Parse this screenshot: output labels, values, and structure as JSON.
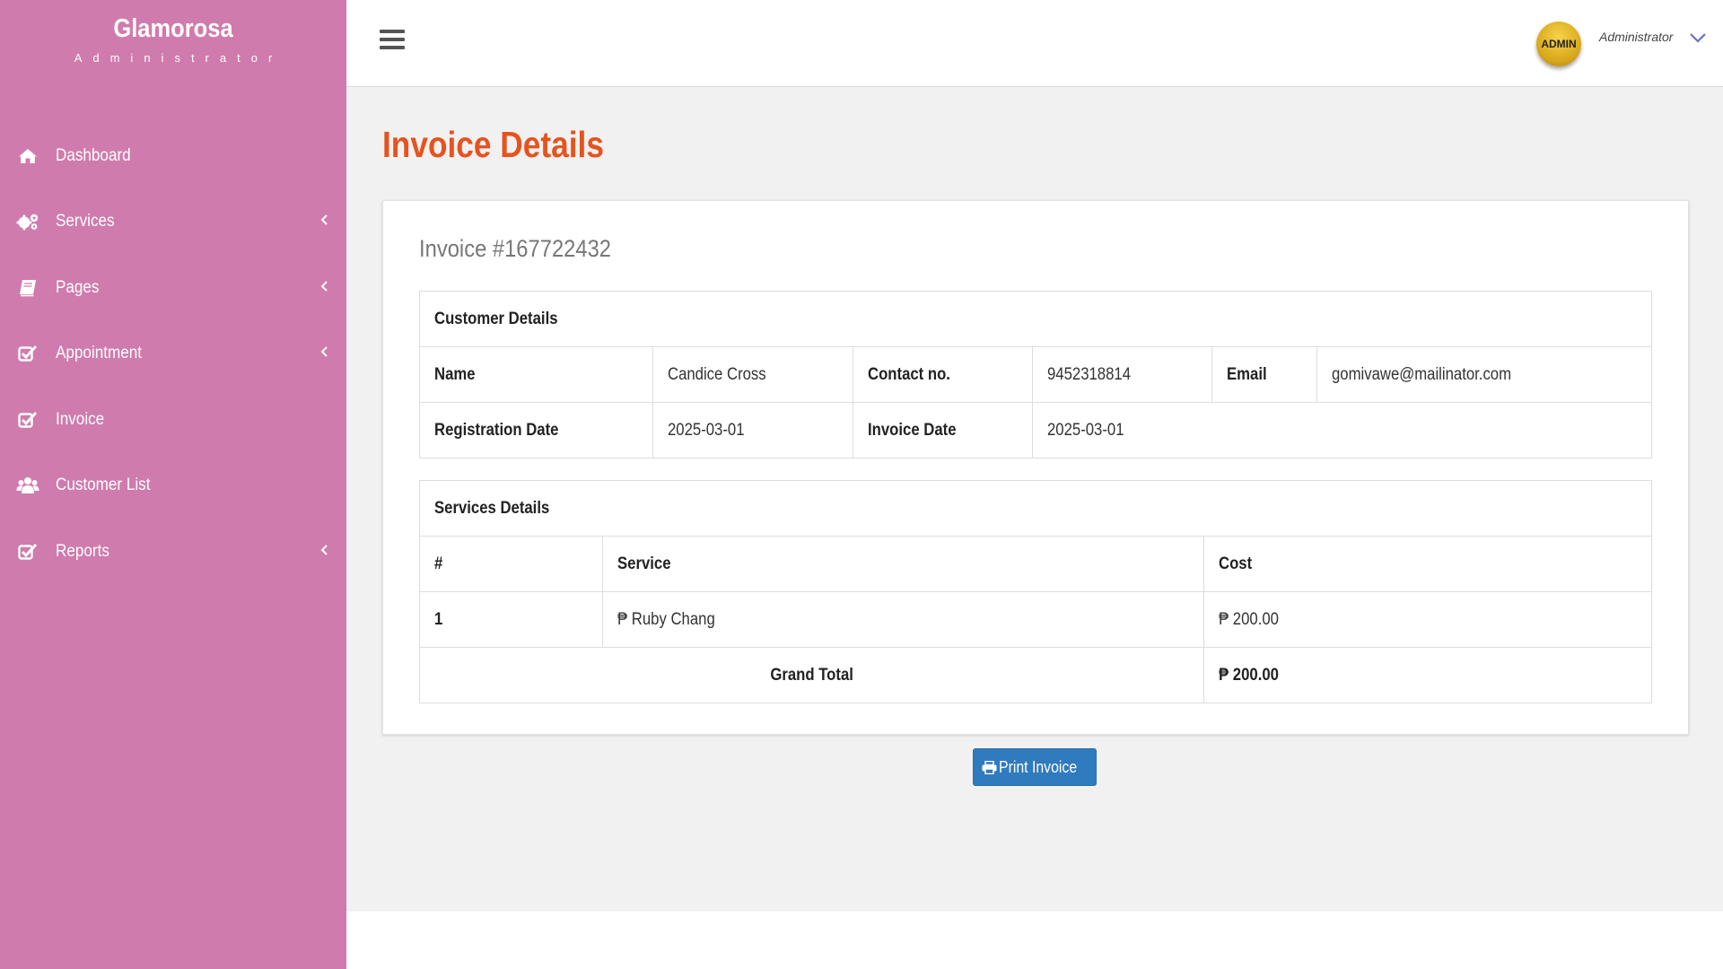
{
  "brand": {
    "title": "Glamorosa",
    "subtitle": "Administrator"
  },
  "sidebar": {
    "items": [
      {
        "label": "Dashboard",
        "icon": "home-icon",
        "has_submenu": false
      },
      {
        "label": "Services",
        "icon": "gears-icon",
        "has_submenu": true
      },
      {
        "label": "Pages",
        "icon": "book-icon",
        "has_submenu": true
      },
      {
        "label": "Appointment",
        "icon": "check-square-icon",
        "has_submenu": true
      },
      {
        "label": "Invoice",
        "icon": "check-square-icon",
        "has_submenu": false
      },
      {
        "label": "Customer List",
        "icon": "users-icon",
        "has_submenu": false
      },
      {
        "label": "Reports",
        "icon": "check-square-icon",
        "has_submenu": true
      }
    ]
  },
  "topbar": {
    "avatar_text": "ADMIN",
    "user_name": "Administrator"
  },
  "page": {
    "title": "Invoice Details",
    "invoice_number": "Invoice #167722432"
  },
  "customer": {
    "section_title": "Customer Details",
    "name_label": "Name",
    "name": "Candice Cross",
    "contact_label": "Contact no.",
    "contact": "9452318814",
    "email_label": "Email",
    "email": "gomivawe@mailinator.com",
    "reg_date_label": "Registration Date",
    "reg_date": "2025-03-01",
    "invoice_date_label": "Invoice Date",
    "invoice_date": "2025-03-01"
  },
  "services": {
    "section_title": "Services Details",
    "columns": [
      "#",
      "Service",
      "Cost"
    ],
    "rows": [
      {
        "num": "1",
        "service": "₱ Ruby Chang",
        "cost": "₱ 200.00"
      }
    ],
    "grand_total_label": "Grand Total",
    "grand_total": "₱ 200.00"
  },
  "actions": {
    "print_label": "Print Invoice"
  },
  "colors": {
    "sidebar_bg": "#d07bad",
    "title_accent": "#e6531e",
    "button_primary": "#2f7bbd",
    "avatar_gold": "#d8a71a"
  }
}
